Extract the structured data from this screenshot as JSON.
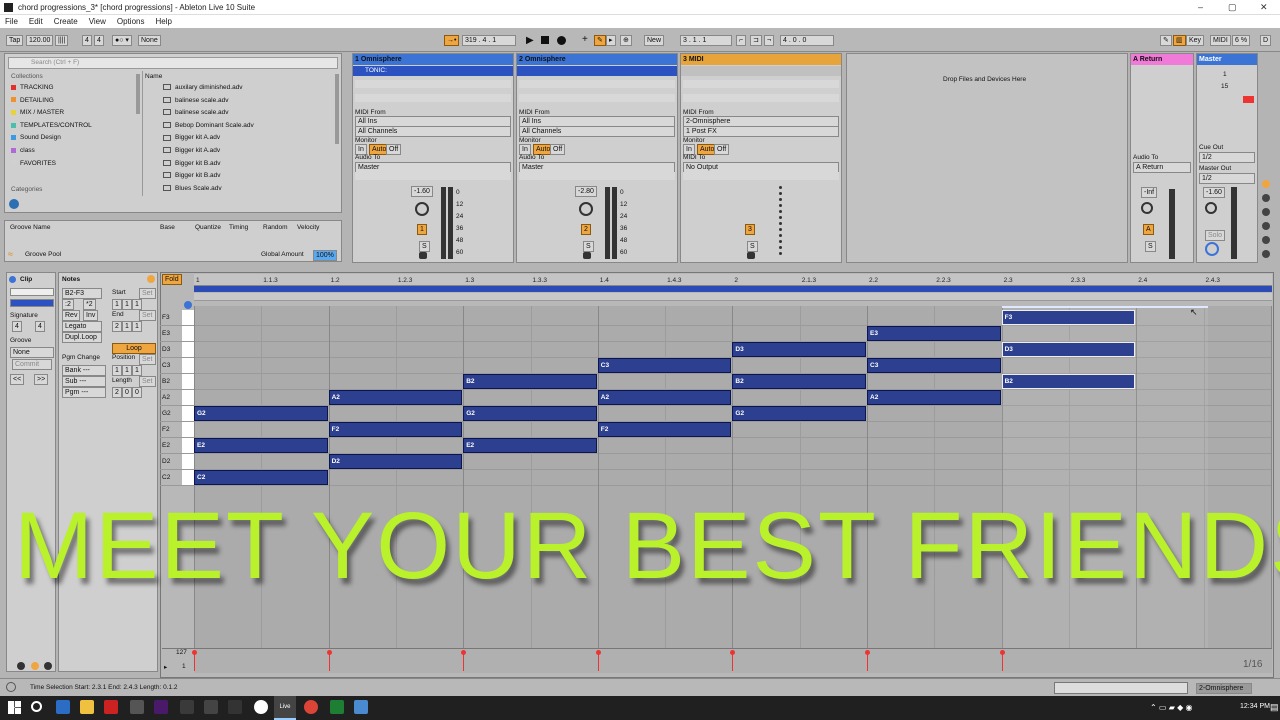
{
  "window": {
    "title": "chord progressions_3*  [chord progressions] - Ableton Live 10 Suite"
  },
  "menu": [
    "File",
    "Edit",
    "Create",
    "View",
    "Options",
    "Help"
  ],
  "transport": {
    "tap": "Tap",
    "tempo": "120.00",
    "sig_num": "4",
    "sig_den": "4",
    "metro": "1 Bar",
    "quant": "None",
    "arr_pos": "319 .  4 .  1",
    "loop_start": "3 .  1 .  1",
    "loop_len": "4 .  0 .  0",
    "new": "New",
    "key": "Key",
    "midi": "MIDI",
    "cpu": "6 %",
    "d": "D"
  },
  "browser": {
    "search_placeholder": "Search (Ctrl + F)",
    "collections_label": "Collections",
    "categories_label": "Categories",
    "name_header": "Name",
    "collections": [
      {
        "label": "TRACKING",
        "color": "#e0322b"
      },
      {
        "label": "DETAILING",
        "color": "#f0912c"
      },
      {
        "label": "MIX / MASTER",
        "color": "#e6d23a"
      },
      {
        "label": "TEMPLATES/CONTROL",
        "color": "#4cbfa8"
      },
      {
        "label": "Sound Design",
        "color": "#3c9be0"
      },
      {
        "label": "class",
        "color": "#b06ad8"
      },
      {
        "label": "FAVORITES",
        "color": "#d0d0d0"
      }
    ],
    "files": [
      "auxilary diminished.adv",
      "balinese scale.adv",
      "balinese scale.adv",
      "Bebop Dominant Scale.adv",
      "Bigger kit A.adv",
      "Bigger kit A.adv",
      "Bigger kit B.adv",
      "Bigger kit B.adv",
      "Blues Scale.adv"
    ]
  },
  "groove": {
    "col_name": "Groove Name",
    "col_base": "Base",
    "col_quantize": "Quantize",
    "col_timing": "Timing",
    "col_random": "Random",
    "col_velocity": "Velocity",
    "pool": "Groove Pool",
    "global_amount_label": "Global Amount",
    "global_amount": "100%"
  },
  "tracks": [
    {
      "name": "1 Omnisphere",
      "clip": "TONIC:",
      "midi_from": "All Ins",
      "channel": "All Channels",
      "audio_to": "Master",
      "vol": "-1.60",
      "num": "1",
      "color": "#3c74d6"
    },
    {
      "name": "2 Omnisphere",
      "clip": "",
      "midi_from": "All Ins",
      "channel": "All Channels",
      "audio_to": "Master",
      "vol": "-2.80",
      "num": "2",
      "color": "#3c74d6"
    },
    {
      "name": "3 MIDI",
      "clip": "",
      "midi_from": "2-Omnisphere",
      "channel": "1 Post FX",
      "audio_to": "No Output",
      "vol": "",
      "num": "3",
      "color": "#e7a43a"
    }
  ],
  "mixer_labels": {
    "midi_from": "MIDI From",
    "monitor": "Monitor",
    "in": "In",
    "auto": "Auto",
    "off": "Off",
    "audio_to": "Audio To",
    "midi_to": "MIDI To",
    "s": "S",
    "db_marks": [
      "0",
      "12",
      "24",
      "36",
      "48",
      "60"
    ]
  },
  "drop_text": "Drop Files and Devices Here",
  "returns": {
    "a_name": "A Return",
    "a_vol": "-Inf",
    "a_letter": "A",
    "master": "Master",
    "cue_out": "Cue Out",
    "cue_val": "1/2",
    "master_out": "Master Out",
    "master_val": "1/2",
    "master_vol": "-1.60",
    "solo": "Solo",
    "n1": "1",
    "n15": "15"
  },
  "clip_panel": {
    "clip": "Clip",
    "notes": "Notes",
    "range": "B2-F3",
    "start": "Start",
    "end": "End",
    "signature": "Signature",
    "sig_n": "4",
    "sig_d": "4",
    "groove": "Groove",
    "groove_val": "None",
    "commit": "Commit",
    "half": ":2",
    "double": "*2",
    "rev": "Rev",
    "inv": "Inv",
    "legato": "Legato",
    "dupl": "Dupl.Loop",
    "loop": "Loop",
    "pgm_change": "Pgm Change",
    "bank": "Bank ---",
    "sub": "Sub ---",
    "pgm": "Pgm ---",
    "position": "Position",
    "length": "Length",
    "set": "Set",
    "v1": "1",
    "v2": "2",
    "v0": "0",
    "fold": "Fold"
  },
  "ruler": [
    "1",
    "1.1.3",
    "1.2",
    "1.2.3",
    "1.3",
    "1.3.3",
    "1.4",
    "1.4.3",
    "2",
    "2.1.3",
    "2.2",
    "2.2.3",
    "2.3",
    "2.3.3",
    "2.4",
    "2.4.3"
  ],
  "keys": [
    "F3",
    "E3",
    "D3",
    "C3",
    "B2",
    "A2",
    "G2",
    "F2",
    "E2",
    "D2",
    "C2"
  ],
  "notes": [
    {
      "p": "C2",
      "s": 0,
      "l": 1
    },
    {
      "p": "E2",
      "s": 0,
      "l": 1
    },
    {
      "p": "G2",
      "s": 0,
      "l": 1
    },
    {
      "p": "D2",
      "s": 1,
      "l": 1
    },
    {
      "p": "F2",
      "s": 1,
      "l": 1
    },
    {
      "p": "A2",
      "s": 1,
      "l": 1
    },
    {
      "p": "E2",
      "s": 2,
      "l": 1
    },
    {
      "p": "G2",
      "s": 2,
      "l": 1
    },
    {
      "p": "B2",
      "s": 2,
      "l": 1
    },
    {
      "p": "F2",
      "s": 3,
      "l": 1
    },
    {
      "p": "A2",
      "s": 3,
      "l": 1
    },
    {
      "p": "C3",
      "s": 3,
      "l": 1
    },
    {
      "p": "G2",
      "s": 4,
      "l": 1
    },
    {
      "p": "B2",
      "s": 4,
      "l": 1
    },
    {
      "p": "D3",
      "s": 4,
      "l": 1
    },
    {
      "p": "A2",
      "s": 5,
      "l": 1
    },
    {
      "p": "C3",
      "s": 5,
      "l": 1
    },
    {
      "p": "E3",
      "s": 5,
      "l": 1
    },
    {
      "p": "B2",
      "s": 6,
      "l": 1,
      "sel": true
    },
    {
      "p": "D3",
      "s": 6,
      "l": 1,
      "sel": true
    },
    {
      "p": "F3",
      "s": 6,
      "l": 1,
      "sel": true
    }
  ],
  "velocity": {
    "max": "127",
    "min": "1",
    "zoom": "1/16"
  },
  "overlay_text": "MEET YOUR BEST FRIENDS",
  "status": {
    "selection": "Time Selection  Start: 2.3.1  End: 2.4.3  Length: 0.1.2",
    "track": "2-Omnisphere"
  },
  "taskbar": {
    "time": "12:34 PM",
    "live": "Live"
  }
}
